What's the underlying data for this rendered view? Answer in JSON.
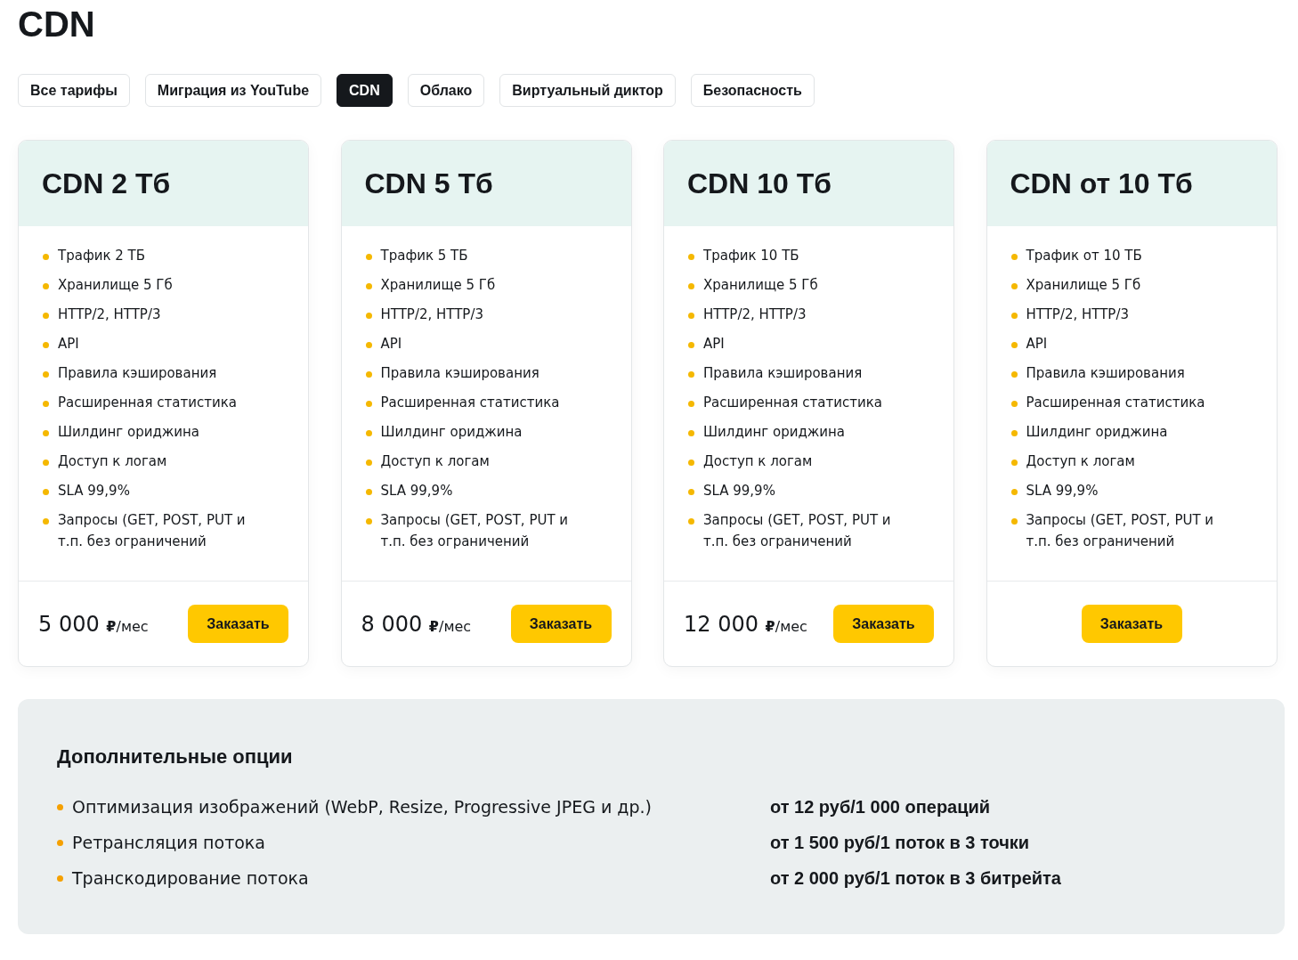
{
  "page_title": "CDN",
  "tabs": [
    {
      "label": "Все тарифы",
      "selected": false
    },
    {
      "label": "Миграция из YouTube",
      "selected": false
    },
    {
      "label": "CDN",
      "selected": true
    },
    {
      "label": "Облако",
      "selected": false
    },
    {
      "label": "Виртуальный диктор",
      "selected": false
    },
    {
      "label": "Безопасность",
      "selected": false
    }
  ],
  "plans": [
    {
      "name": "CDN 2 Тб",
      "features": [
        "Трафик 2 ТБ",
        "Хранилище 5 Гб",
        "HTTP/2, HTTP/3",
        "API",
        "Правила кэширования",
        "Расширенная статистика",
        "Шилдинг ориджина",
        "Доступ к логам",
        "SLA 99,9%",
        "Запросы (GET, POST, PUT и т.п. без ограничений"
      ],
      "price": "5 000",
      "unit": "**₽**/мес",
      "button": "Заказать"
    },
    {
      "name": "CDN 5 Тб",
      "features": [
        "Трафик 5 ТБ",
        "Хранилище 5 Гб",
        "HTTP/2, HTTP/3",
        "API",
        "Правила кэширования",
        "Расширенная статистика",
        "Шилдинг ориджина",
        "Доступ к логам",
        "SLA 99,9%",
        "Запросы (GET, POST, PUT и т.п. без ограничений"
      ],
      "price": "8 000",
      "unit": "**₽**/мес",
      "button": "Заказать"
    },
    {
      "name": "CDN 10 Тб",
      "features": [
        "Трафик 10 ТБ",
        "Хранилище 5 Гб",
        "HTTP/2, HTTP/3",
        "API",
        "Правила кэширования",
        "Расширенная статистика",
        "Шилдинг ориджина",
        "Доступ к логам",
        "SLA 99,9%",
        "Запросы (GET, POST, PUT и т.п. без ограничений"
      ],
      "price": "12 000",
      "unit": "**₽**/мес",
      "button": "Заказать"
    },
    {
      "name": "CDN от 10 Тб",
      "features": [
        "Трафик от 10 ТБ",
        "Хранилище 5 Гб",
        "HTTP/2, HTTP/3",
        "API",
        "Правила кэширования",
        "Расширенная статистика",
        "Шилдинг ориджина",
        "Доступ к логам",
        "SLA 99,9%",
        "Запросы (GET, POST, PUT и т.п. без ограничений"
      ],
      "button": "Заказать"
    }
  ],
  "extra_options": {
    "title": "Дополнительные опции",
    "items": [
      {
        "name": "Оптимизация изображений (WebP, Resize, Progressive JPEG и др.)",
        "price": "от 12 руб/1 000 операций"
      },
      {
        "name": "Ретрансляция потока",
        "price": "от 1 500 руб/1 поток в 3 точки"
      },
      {
        "name": "Транскодирование потока",
        "price": "от 2 000 руб/1 поток в 3 битрейта"
      }
    ]
  }
}
